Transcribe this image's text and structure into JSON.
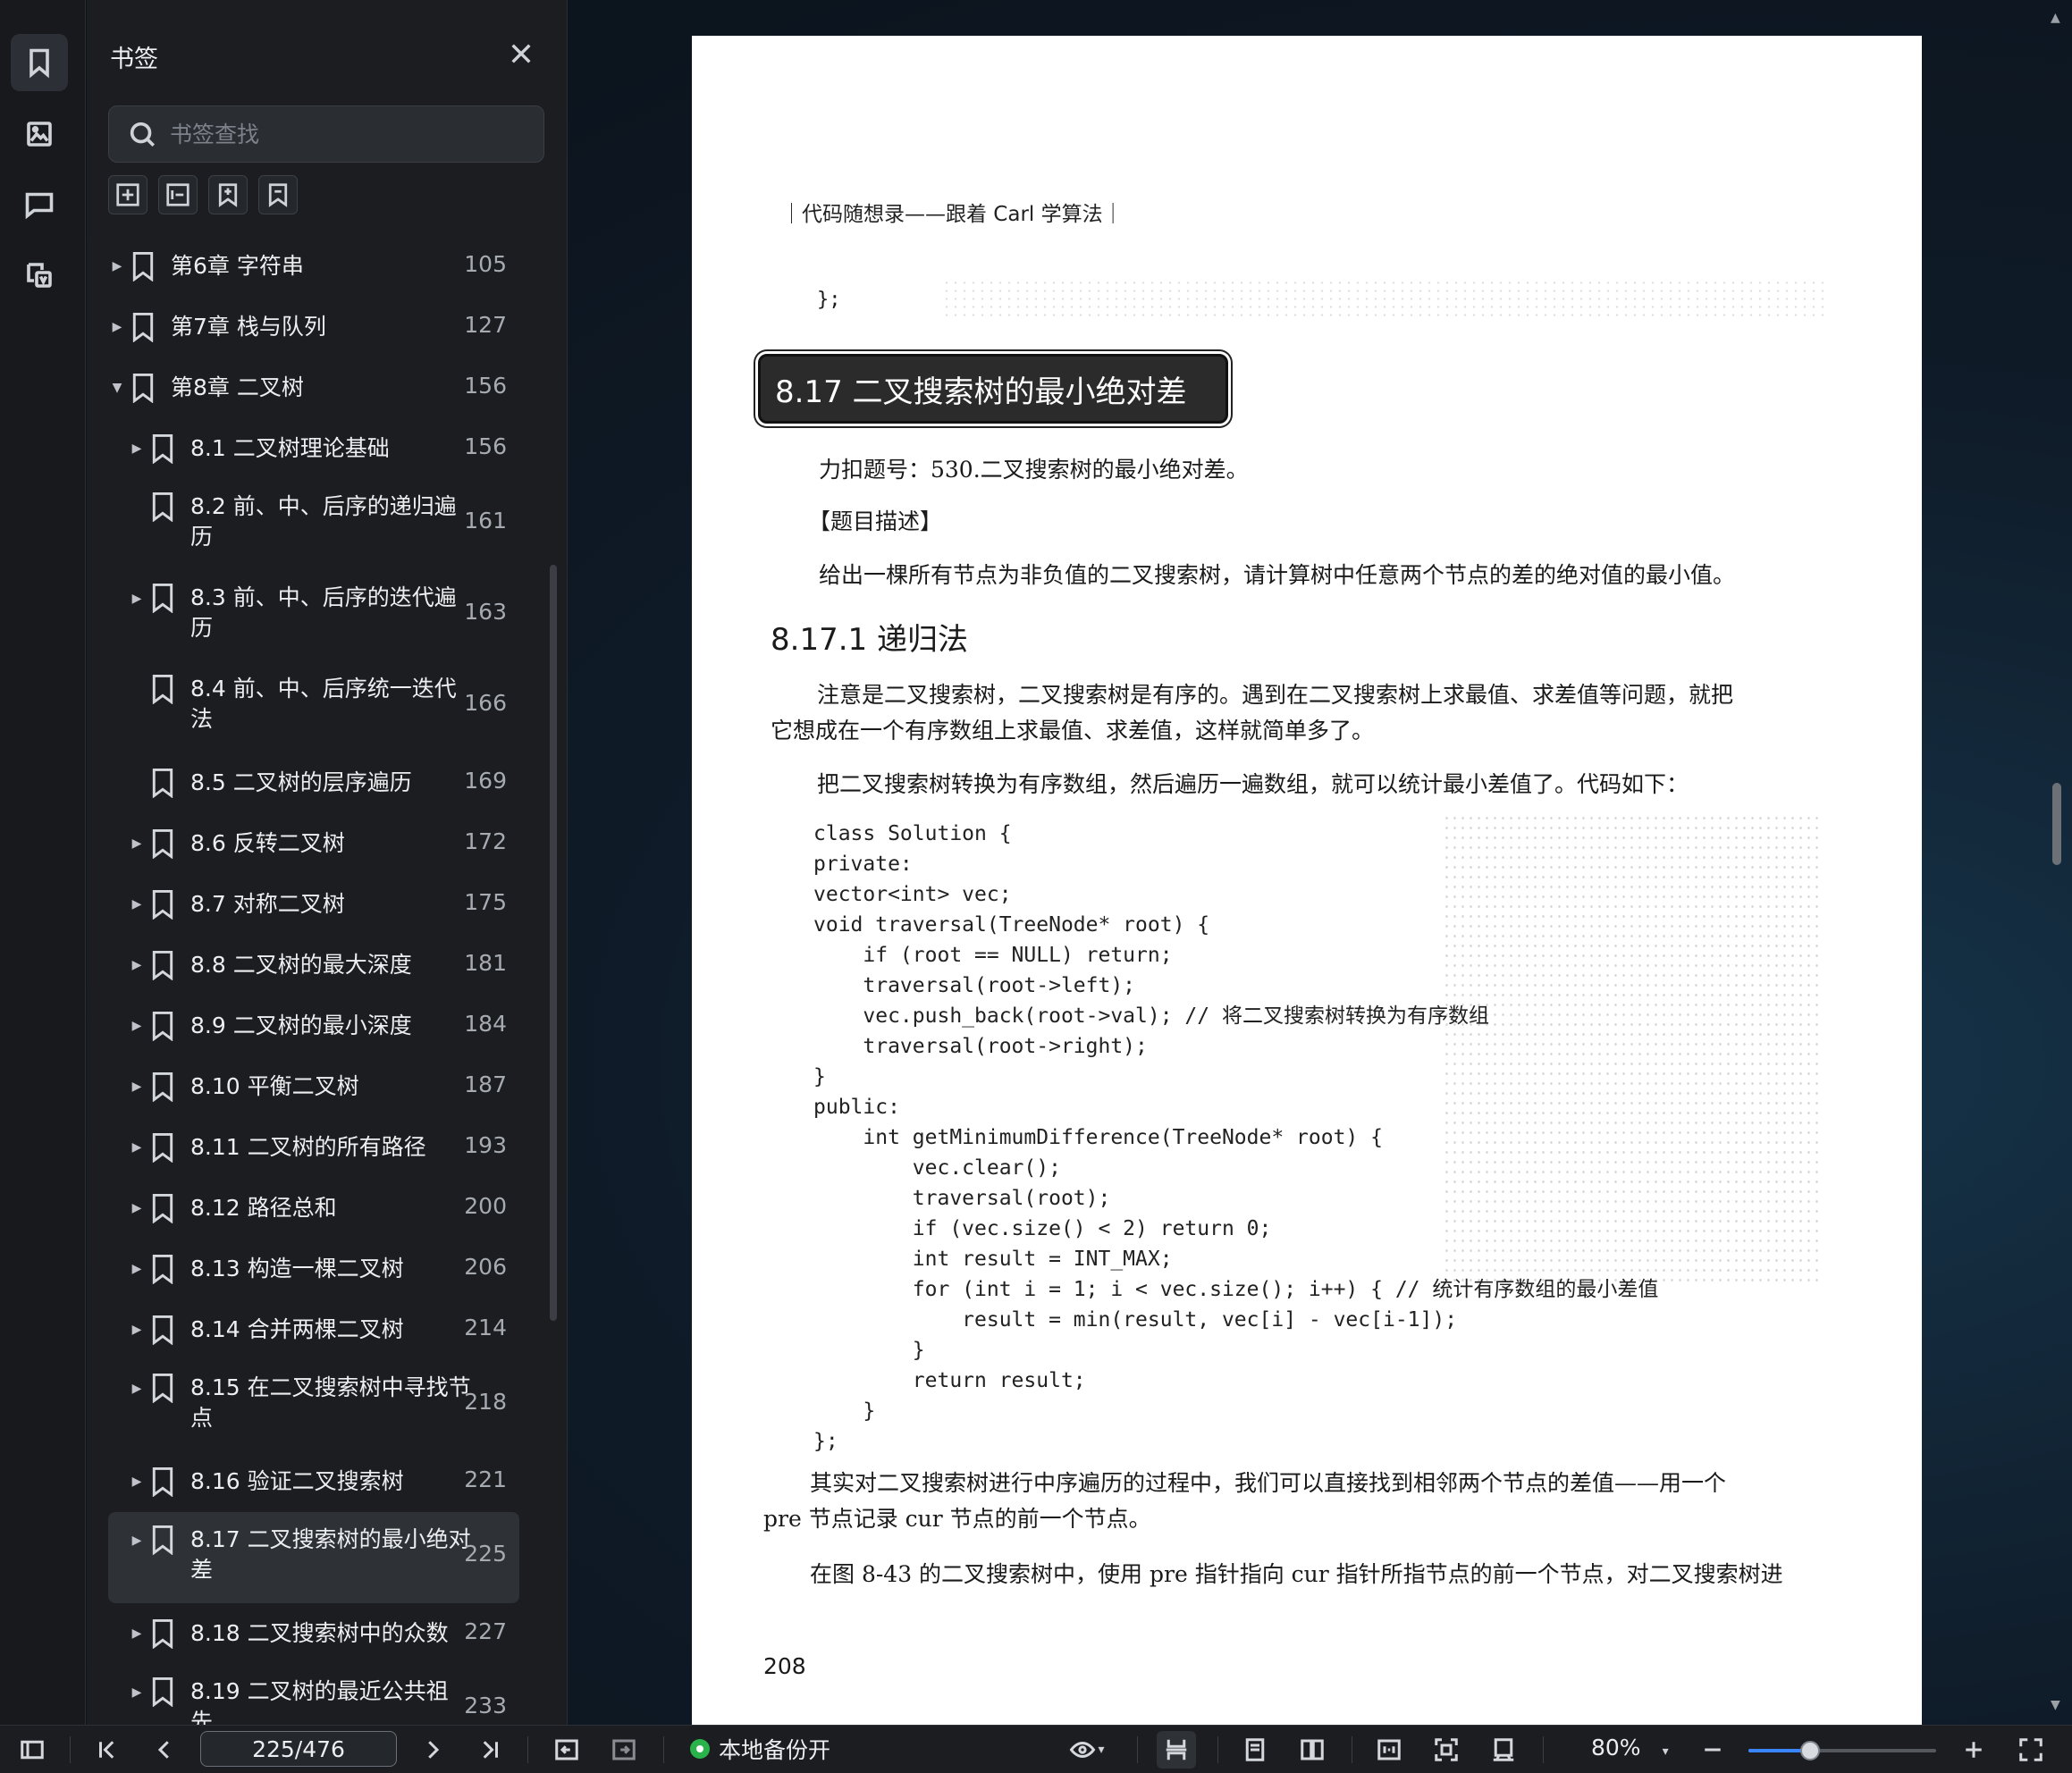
{
  "sidebar": {
    "title": "书签",
    "search_placeholder": "书签查找",
    "items": [
      {
        "label": "第6章 字符串",
        "page": "105",
        "level": 0,
        "arrow": "▶",
        "label2": ""
      },
      {
        "label": "第7章 栈与队列",
        "page": "127",
        "level": 0,
        "arrow": "▶",
        "label2": ""
      },
      {
        "label": "第8章 二叉树",
        "page": "156",
        "level": 0,
        "arrow": "▼",
        "label2": ""
      },
      {
        "label": "8.1 二叉树理论基础",
        "page": "156",
        "level": 1,
        "arrow": "▶",
        "label2": ""
      },
      {
        "label": "8.2 前、中、后序的递归遍",
        "page": "161",
        "level": 1,
        "arrow": "",
        "label2": "历"
      },
      {
        "label": "8.3 前、中、后序的迭代遍",
        "page": "163",
        "level": 1,
        "arrow": "▶",
        "label2": "历"
      },
      {
        "label": "8.4 前、中、后序统一迭代",
        "page": "166",
        "level": 1,
        "arrow": "",
        "label2": "法"
      },
      {
        "label": "8.5 二叉树的层序遍历",
        "page": "169",
        "level": 1,
        "arrow": "",
        "label2": ""
      },
      {
        "label": "8.6 反转二叉树",
        "page": "172",
        "level": 1,
        "arrow": "▶",
        "label2": ""
      },
      {
        "label": "8.7 对称二叉树",
        "page": "175",
        "level": 1,
        "arrow": "▶",
        "label2": ""
      },
      {
        "label": "8.8 二叉树的最大深度",
        "page": "181",
        "level": 1,
        "arrow": "▶",
        "label2": ""
      },
      {
        "label": "8.9 二叉树的最小深度",
        "page": "184",
        "level": 1,
        "arrow": "▶",
        "label2": ""
      },
      {
        "label": "8.10 平衡二叉树",
        "page": "187",
        "level": 1,
        "arrow": "▶",
        "label2": ""
      },
      {
        "label": "8.11 二叉树的所有路径",
        "page": "193",
        "level": 1,
        "arrow": "▶",
        "label2": ""
      },
      {
        "label": "8.12 路径总和",
        "page": "200",
        "level": 1,
        "arrow": "▶",
        "label2": ""
      },
      {
        "label": "8.13 构造一棵二叉树",
        "page": "206",
        "level": 1,
        "arrow": "▶",
        "label2": ""
      },
      {
        "label": "8.14 合并两棵二叉树",
        "page": "214",
        "level": 1,
        "arrow": "▶",
        "label2": ""
      },
      {
        "label": "8.15 在二叉搜索树中寻找节",
        "page": "218",
        "level": 1,
        "arrow": "▶",
        "label2": "点"
      },
      {
        "label": "8.16 验证二叉搜索树",
        "page": "221",
        "level": 1,
        "arrow": "▶",
        "label2": ""
      },
      {
        "label": "8.17 二叉搜索树的最小绝对",
        "page": "225",
        "level": 1,
        "arrow": "▶",
        "label2": "差"
      },
      {
        "label": "8.18 二叉搜索树中的众数",
        "page": "227",
        "level": 1,
        "arrow": "▶",
        "label2": ""
      },
      {
        "label": "8.19 二叉树的最近公共祖",
        "page": "233",
        "level": 1,
        "arrow": "▶",
        "label2": "先"
      }
    ]
  },
  "document": {
    "running_header": "｜代码随想录——跟着 Carl 学算法｜",
    "fragment": "};",
    "section_title": "8.17  二叉搜索树的最小绝对差",
    "leetcode": "力扣题号：530.二叉搜索树的最小绝对差。",
    "desc_head": "【题目描述】",
    "desc": "给出一棵所有节点为非负值的二叉搜索树，请计算树中任意两个节点的差的绝对值的最小值。",
    "subsection": "8.17.1  递归法",
    "para1_line1": "注意是二叉搜索树，二叉搜索树是有序的。遇到在二叉搜索树上求最值、求差值等问题，就把",
    "para1_line2": "它想成在一个有序数组上求最值、求差值，这样就简单多了。",
    "para2": "把二叉搜索树转换为有序数组，然后遍历一遍数组，就可以统计最小差值了。代码如下：",
    "code": "class Solution {\nprivate:\nvector<int> vec;\nvoid traversal(TreeNode* root) {\n    if (root == NULL) return;\n    traversal(root->left);\n    vec.push_back(root->val); // 将二叉搜索树转换为有序数组\n    traversal(root->right);\n}\npublic:\n    int getMinimumDifference(TreeNode* root) {\n        vec.clear();\n        traversal(root);\n        if (vec.size() < 2) return 0;\n        int result = INT_MAX;\n        for (int i = 1; i < vec.size(); i++) { // 统计有序数组的最小差值\n            result = min(result, vec[i] - vec[i-1]);\n        }\n        return result;\n    }\n};",
    "para3_line1": "其实对二叉搜索树进行中序遍历的过程中，我们可以直接找到相邻两个节点的差值——用一个",
    "para3_line2": "pre 节点记录 cur 节点的前一个节点。",
    "para4": "在图 8-43 的二叉搜索树中，使用 pre 指针指向 cur 指针所指节点的前一个节点，对二叉搜索树进",
    "page_number": "208"
  },
  "bottombar": {
    "page_indicator": "225/476",
    "backup_label": "本地备份开",
    "zoom": "80%",
    "zoom_level": 0.33
  }
}
